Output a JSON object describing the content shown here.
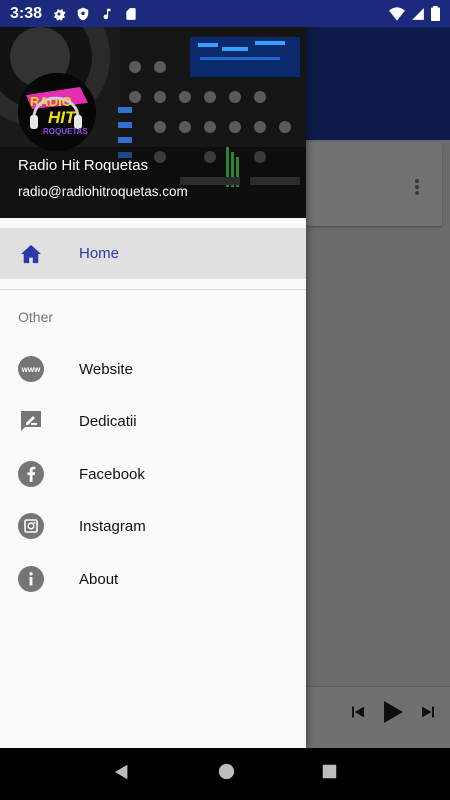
{
  "status_bar": {
    "time": "3:38",
    "icons": [
      "settings-icon",
      "shield-icon",
      "music-note-icon",
      "sd-card-icon",
      "wifi-icon",
      "signal-icon",
      "battery-icon"
    ]
  },
  "drawer": {
    "header": {
      "station_name": "Radio Hit Roquetas",
      "email": "radio@radiohitroquetas.com",
      "logo_text": [
        "RADIO",
        "HIT",
        "ROQUETAS"
      ]
    },
    "home": {
      "label": "Home",
      "icon": "home-icon"
    },
    "section_title": "Other",
    "items": [
      {
        "label": "Website",
        "icon": "www-icon"
      },
      {
        "label": "Dedicatii",
        "icon": "edit-message-icon"
      },
      {
        "label": "Facebook",
        "icon": "facebook-icon"
      },
      {
        "label": "Instagram",
        "icon": "instagram-icon"
      },
      {
        "label": "About",
        "icon": "info-icon"
      }
    ]
  },
  "colors": {
    "primary": "#1c2a7d",
    "active_text": "#2a3ba8",
    "icon_gray": "#757575"
  }
}
